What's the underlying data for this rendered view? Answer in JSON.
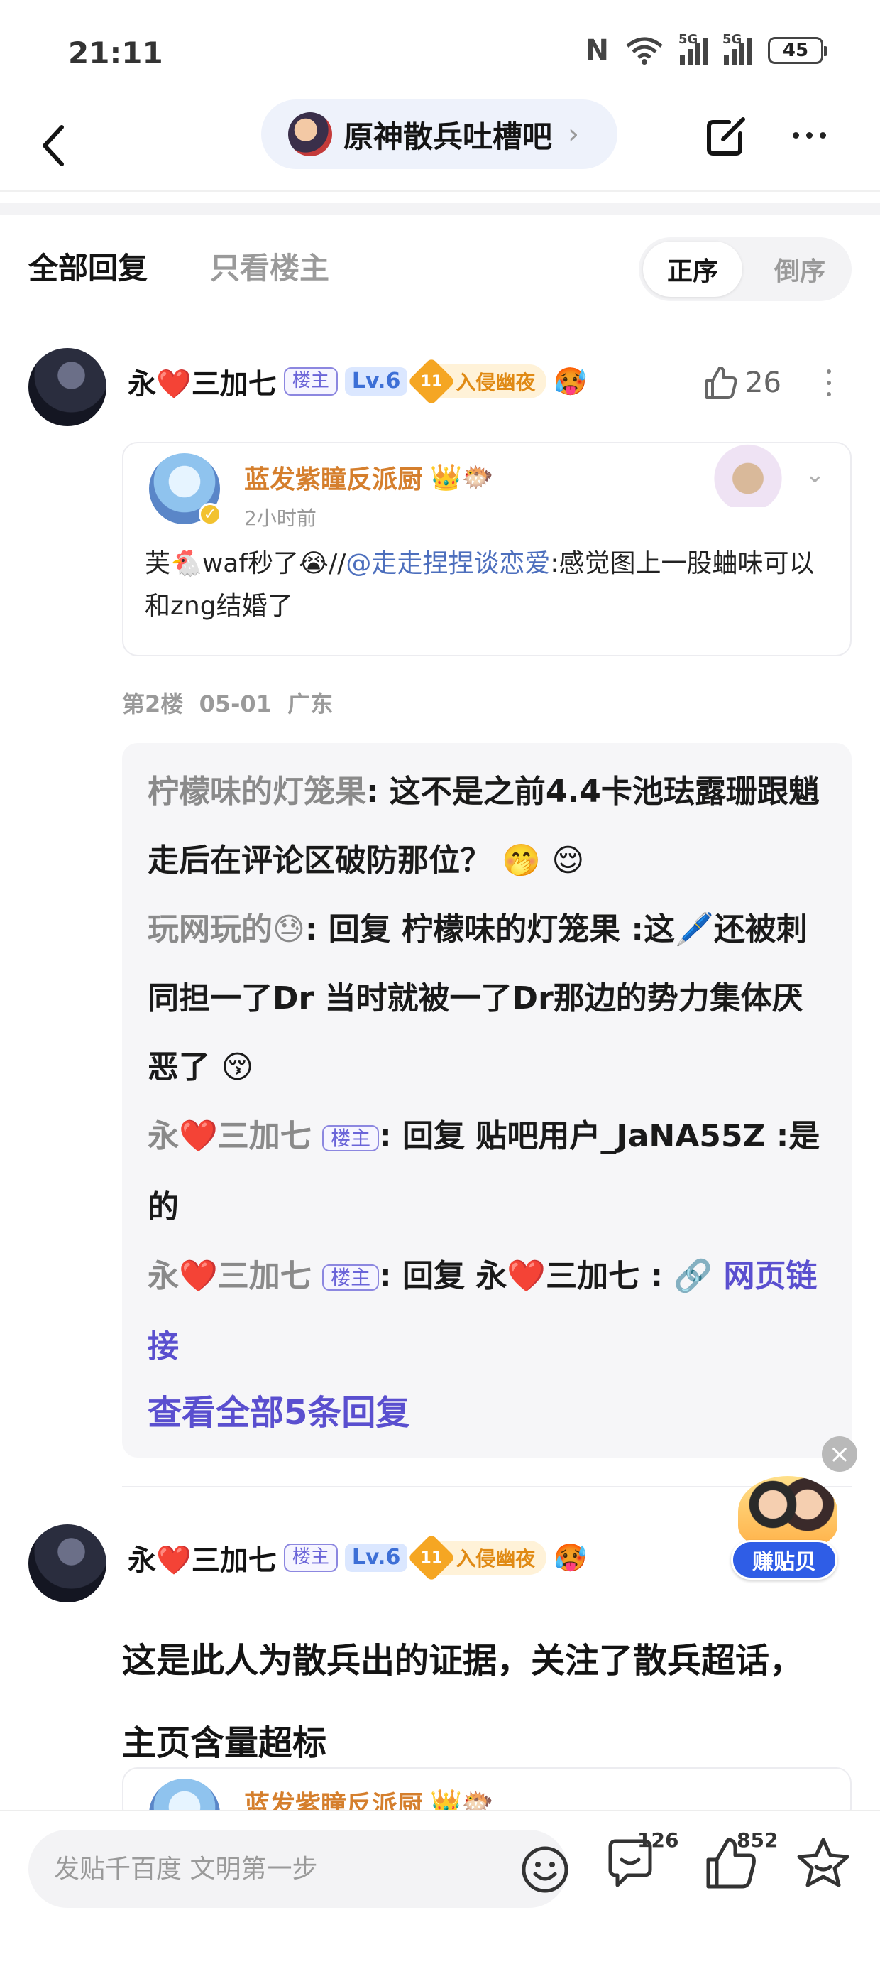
{
  "status_bar": {
    "time": "21:11",
    "net1": "5G",
    "net2": "5G",
    "battery": "45"
  },
  "header": {
    "forum_name": "原神散兵吐槽吧",
    "chevron": "›"
  },
  "tabs": {
    "all": "全部回复",
    "op_only": "只看楼主",
    "order_asc": "正序",
    "order_desc": "倒序"
  },
  "post1": {
    "author": {
      "name_prefix": "永",
      "heart": "❤️",
      "name_suffix": "三加七",
      "op_badge": "楼主",
      "level": "Lv.6",
      "honor_level": "11",
      "honor_title": "入侵幽夜",
      "emoji": "🥵"
    },
    "likes": "26",
    "quote": {
      "author": "蓝发紫瞳反派厨",
      "author_emojis": "👑🐡",
      "time": "2小时前",
      "text_a": "芙🐔waf秒了😭//",
      "mention": "@走走捏捏谈恋爱",
      "text_b": ":感觉图上一股蛐味可以和zng结婚了"
    },
    "floor": "第2楼",
    "date": "05-01",
    "location": "广东",
    "replies": [
      {
        "user": "柠檬味的灯笼果",
        "text": ": 这不是之前4.4卡池珐露珊跟魈走后在评论区破防那位？ 🤭 😌"
      },
      {
        "user": "玩网玩的😓",
        "text": ": 回复 柠檬味的灯笼果 :这🖊️还被刺同担一了Dr 当时就被一了Dr那边的势力集体厌恶了 😚"
      },
      {
        "user": "永❤️三加七",
        "op": "楼主",
        "text": ": 回复 贴吧用户_JaNA55Z :是的"
      },
      {
        "user": "永❤️三加七",
        "op": "楼主",
        "text": ": 回复 永❤️三加七 : ",
        "link": "🔗 网页链接"
      }
    ],
    "view_all": "查看全部5条回复"
  },
  "post2": {
    "author": {
      "name_prefix": "永",
      "heart": "❤️",
      "name_suffix": "三加七",
      "op_badge": "楼主",
      "level": "Lv.6",
      "honor_level": "11",
      "honor_title": "入侵幽夜",
      "emoji": "🥵"
    },
    "text": "这是此人为散兵出的证据，关注了散兵超话，主页含量超标",
    "quote_author": "蓝发紫瞳反派厨",
    "quote_author_emojis": "👑🐡"
  },
  "ad": {
    "label": "赚贴贝",
    "close": "×"
  },
  "bottom_bar": {
    "input_placeholder": "发贴千百度 文明第一步",
    "comment_count": "126",
    "like_count": "852"
  },
  "colors": {
    "accent": "#5a4fcf",
    "op_badge": "#6a64d8",
    "quote_author": "#d57f2d",
    "honor": "#e08a14"
  }
}
